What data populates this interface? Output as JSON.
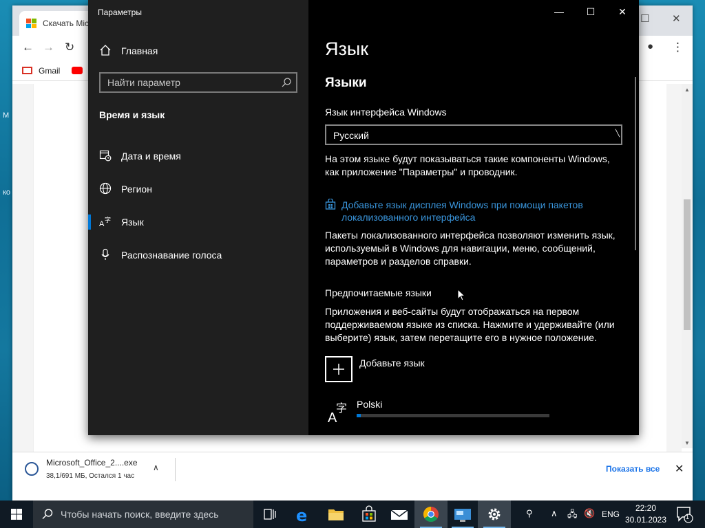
{
  "desktop": {
    "glyphs": [
      "М",
      "ко"
    ]
  },
  "browser": {
    "tab_title": "Скачать Mic",
    "bookmarks": {
      "gmail": "Gmail"
    }
  },
  "download": {
    "file_name": "Microsoft_Office_2....exe",
    "status": "38,1/691 МБ, Остался 1 час",
    "show_all": "Показать все"
  },
  "settings": {
    "app_title": "Параметры",
    "home": "Главная",
    "search_placeholder": "Найти параметр",
    "section": "Время и язык",
    "nav": [
      {
        "label": "Дата и время",
        "icon": "calendar-clock-icon"
      },
      {
        "label": "Регион",
        "icon": "globe-icon"
      },
      {
        "label": "Язык",
        "icon": "language-icon",
        "active": true
      },
      {
        "label": "Распознавание голоса",
        "icon": "microphone-icon"
      }
    ],
    "page_title": "Язык",
    "languages_heading": "Языки",
    "interface_label": "Язык интерфейса Windows",
    "interface_value": "Русский",
    "interface_desc": "На этом языке будут показываться такие компоненты Windows, как приложение \"Параметры\" и проводник.",
    "link_text": "Добавьте язык дисплея Windows при помощи пакетов локализованного интерфейса",
    "packs_desc": "Пакеты локализованного интерфейса позволяют изменить язык, используемый в Windows для навигации, меню, сообщений, параметров и разделов справки.",
    "preferred_heading": "Предпочитаемые языки",
    "preferred_desc": "Приложения и веб-сайты будут отображаться на первом поддерживаемом языке из списка. Нажмите и удерживайте (или выберите) язык, затем перетащите его в нужное положение.",
    "add_language": "Добавьте язык",
    "languages": [
      {
        "name": "Polski",
        "progress": 0.02
      }
    ]
  },
  "taskbar": {
    "search_placeholder": "Чтобы начать поиск, введите здесь",
    "lang": "ENG",
    "time": "22:20",
    "date": "30.01.2023",
    "notification_count": "1"
  },
  "colors": {
    "accent": "#0078d7",
    "link": "#3a96dd"
  }
}
